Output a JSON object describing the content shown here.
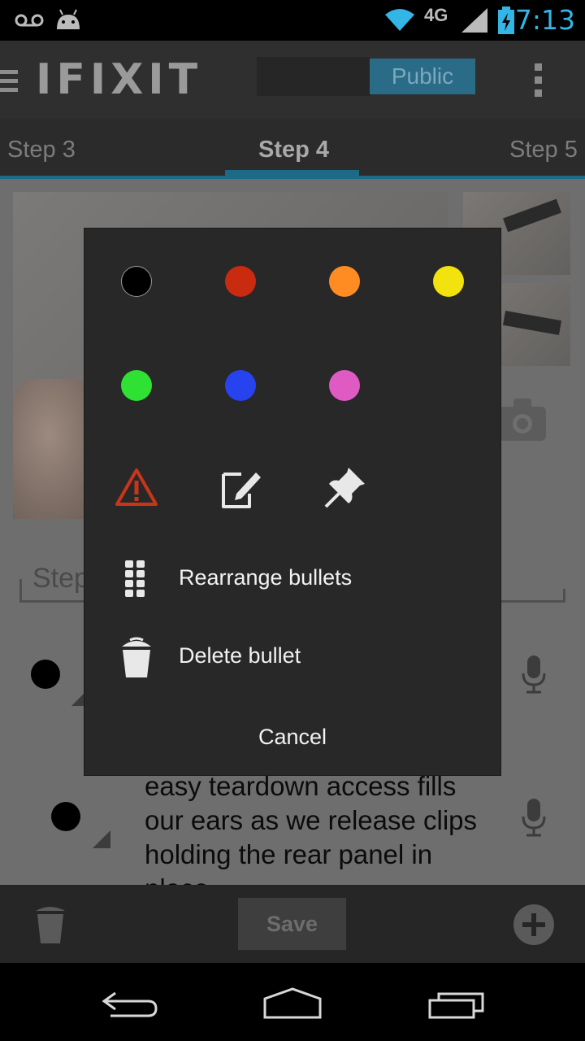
{
  "status_bar": {
    "time": "7:13",
    "network": "4G",
    "icons": [
      "voicemail-icon",
      "android-icon",
      "wifi-icon",
      "signal-icon",
      "battery-charging-icon"
    ]
  },
  "app_bar": {
    "logo": "IFIXIT",
    "visibility_button": "Public",
    "icons": [
      "menu-icon",
      "overflow-menu-icon"
    ]
  },
  "tabs": [
    {
      "label": "Step 3",
      "active": false
    },
    {
      "label": "Step 4",
      "active": true
    },
    {
      "label": "Step 5",
      "active": false
    }
  ],
  "editor": {
    "step_title_placeholder": "Step",
    "bullet_text": "easy teardown access fills our ears as we release clips holding the rear panel in place."
  },
  "bottom_bar": {
    "save_label": "Save",
    "icons": [
      "trash-icon",
      "add-icon"
    ]
  },
  "dialog": {
    "colors": [
      {
        "name": "black",
        "hex": "#000000"
      },
      {
        "name": "red",
        "hex": "#c92b10"
      },
      {
        "name": "orange",
        "hex": "#ff8c22"
      },
      {
        "name": "yellow",
        "hex": "#f2e20d"
      },
      {
        "name": "green",
        "hex": "#2fe132"
      },
      {
        "name": "blue",
        "hex": "#2743f0"
      },
      {
        "name": "violet",
        "hex": "#e05ac4"
      }
    ],
    "tool_icons": [
      "caution-icon",
      "note-icon",
      "reminder-pin-icon"
    ],
    "rearrange_label": "Rearrange bullets",
    "delete_label": "Delete bullet",
    "cancel_label": "Cancel"
  },
  "nav_bar": {
    "icons": [
      "back-icon",
      "home-icon",
      "recent-apps-icon"
    ]
  }
}
